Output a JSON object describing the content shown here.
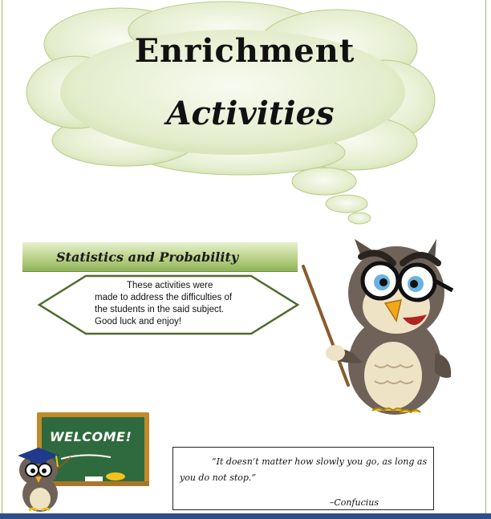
{
  "title": {
    "line1": "Enrichment",
    "line2": "Activities"
  },
  "banner": {
    "label": "Statistics and Probability"
  },
  "intro": {
    "line1": "These activities were",
    "line2": "made to address the difficulties of",
    "line3": "the students in the said subject.",
    "line4": "Good luck and enjoy!"
  },
  "board": {
    "label": "WELCOME!"
  },
  "quote": {
    "text": "“It doesn’t matter how slowly you go, as long as you do not stop.”",
    "author": "–Confucius"
  },
  "colors": {
    "cloud": "#dfe9c6",
    "banner": "#b9d287",
    "hex_border": "#4f6b2a",
    "board": "#2f6a3e",
    "board_frame": "#c08a2c",
    "bottom_bar": "#2e4f86"
  }
}
